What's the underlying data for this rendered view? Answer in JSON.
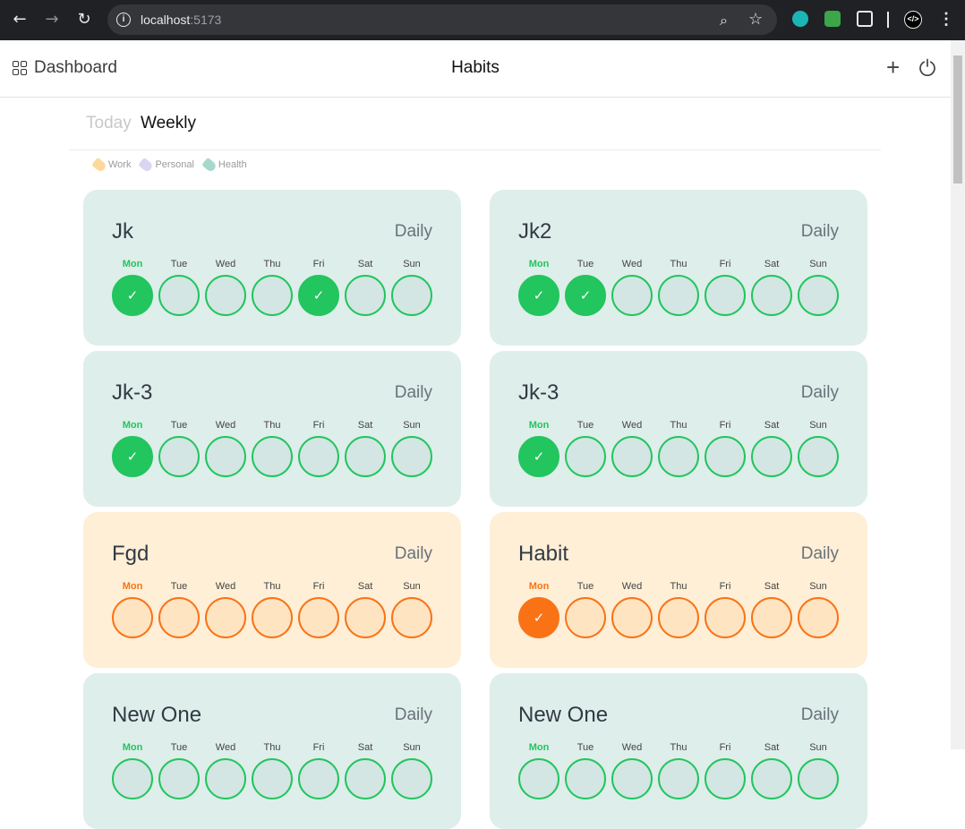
{
  "browser": {
    "url_host": "localhost",
    "url_port": ":5173",
    "back_icon": "←",
    "forward_icon": "→",
    "reload_icon": "↻",
    "info_icon": "i",
    "zoom_icon": "⌕",
    "star_icon": "☆",
    "menu_icon": "⋮",
    "devtools_icon": "</>"
  },
  "header": {
    "dashboard_label": "Dashboard",
    "title": "Habits",
    "add_icon": "+"
  },
  "tabs": {
    "today": "Today",
    "weekly": "Weekly"
  },
  "legend": [
    {
      "label": "Work",
      "color": "#fdd89a"
    },
    {
      "label": "Personal",
      "color": "#d9d6f3"
    },
    {
      "label": "Health",
      "color": "#a7d8cb"
    }
  ],
  "days": [
    "Mon",
    "Tue",
    "Wed",
    "Thu",
    "Fri",
    "Sat",
    "Sun"
  ],
  "check_glyph": "✓",
  "colors": {
    "green": "#22c55e",
    "orange": "#f97316",
    "green_card": "#deeeea",
    "orange_card": "#feefd6"
  },
  "habits": [
    {
      "name": "Jk",
      "frequency": "Daily",
      "category": "green",
      "done": [
        true,
        false,
        false,
        false,
        true,
        false,
        false
      ]
    },
    {
      "name": "Jk2",
      "frequency": "Daily",
      "category": "green",
      "done": [
        true,
        true,
        false,
        false,
        false,
        false,
        false
      ]
    },
    {
      "name": "Jk-3",
      "frequency": "Daily",
      "category": "green",
      "done": [
        true,
        false,
        false,
        false,
        false,
        false,
        false
      ]
    },
    {
      "name": "Jk-3",
      "frequency": "Daily",
      "category": "green",
      "done": [
        true,
        false,
        false,
        false,
        false,
        false,
        false
      ]
    },
    {
      "name": "Fgd",
      "frequency": "Daily",
      "category": "orange",
      "done": [
        false,
        false,
        false,
        false,
        false,
        false,
        false
      ]
    },
    {
      "name": "Habit",
      "frequency": "Daily",
      "category": "orange",
      "done": [
        true,
        false,
        false,
        false,
        false,
        false,
        false
      ]
    },
    {
      "name": "New One",
      "frequency": "Daily",
      "category": "green",
      "done": [
        false,
        false,
        false,
        false,
        false,
        false,
        false
      ]
    },
    {
      "name": "New One",
      "frequency": "Daily",
      "category": "green",
      "done": [
        false,
        false,
        false,
        false,
        false,
        false,
        false
      ]
    }
  ]
}
